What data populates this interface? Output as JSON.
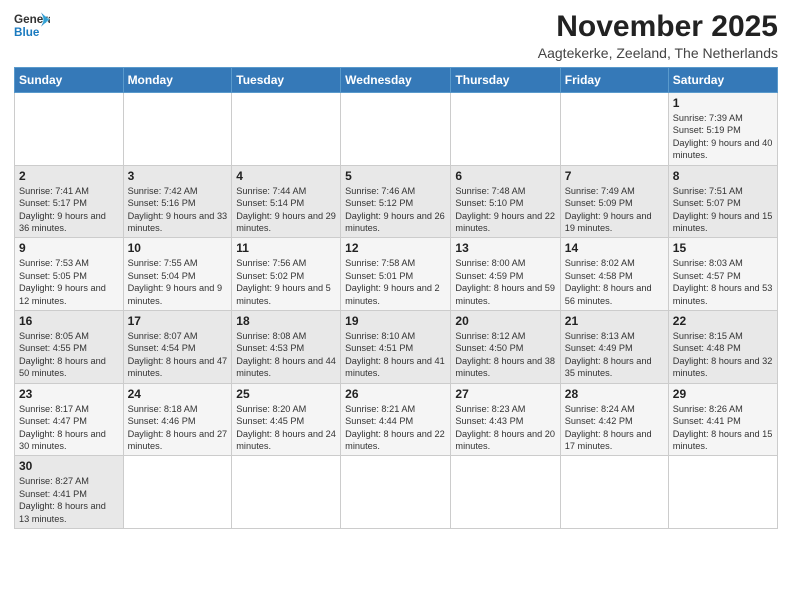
{
  "logo": {
    "text_general": "General",
    "text_blue": "Blue"
  },
  "header": {
    "month_title": "November 2025",
    "subtitle": "Aagtekerke, Zeeland, The Netherlands"
  },
  "weekdays": [
    "Sunday",
    "Monday",
    "Tuesday",
    "Wednesday",
    "Thursday",
    "Friday",
    "Saturday"
  ],
  "weeks": [
    [
      {
        "day": "",
        "info": ""
      },
      {
        "day": "",
        "info": ""
      },
      {
        "day": "",
        "info": ""
      },
      {
        "day": "",
        "info": ""
      },
      {
        "day": "",
        "info": ""
      },
      {
        "day": "",
        "info": ""
      },
      {
        "day": "1",
        "info": "Sunrise: 7:39 AM\nSunset: 5:19 PM\nDaylight: 9 hours and 40 minutes."
      }
    ],
    [
      {
        "day": "2",
        "info": "Sunrise: 7:41 AM\nSunset: 5:17 PM\nDaylight: 9 hours and 36 minutes."
      },
      {
        "day": "3",
        "info": "Sunrise: 7:42 AM\nSunset: 5:16 PM\nDaylight: 9 hours and 33 minutes."
      },
      {
        "day": "4",
        "info": "Sunrise: 7:44 AM\nSunset: 5:14 PM\nDaylight: 9 hours and 29 minutes."
      },
      {
        "day": "5",
        "info": "Sunrise: 7:46 AM\nSunset: 5:12 PM\nDaylight: 9 hours and 26 minutes."
      },
      {
        "day": "6",
        "info": "Sunrise: 7:48 AM\nSunset: 5:10 PM\nDaylight: 9 hours and 22 minutes."
      },
      {
        "day": "7",
        "info": "Sunrise: 7:49 AM\nSunset: 5:09 PM\nDaylight: 9 hours and 19 minutes."
      },
      {
        "day": "8",
        "info": "Sunrise: 7:51 AM\nSunset: 5:07 PM\nDaylight: 9 hours and 15 minutes."
      }
    ],
    [
      {
        "day": "9",
        "info": "Sunrise: 7:53 AM\nSunset: 5:05 PM\nDaylight: 9 hours and 12 minutes."
      },
      {
        "day": "10",
        "info": "Sunrise: 7:55 AM\nSunset: 5:04 PM\nDaylight: 9 hours and 9 minutes."
      },
      {
        "day": "11",
        "info": "Sunrise: 7:56 AM\nSunset: 5:02 PM\nDaylight: 9 hours and 5 minutes."
      },
      {
        "day": "12",
        "info": "Sunrise: 7:58 AM\nSunset: 5:01 PM\nDaylight: 9 hours and 2 minutes."
      },
      {
        "day": "13",
        "info": "Sunrise: 8:00 AM\nSunset: 4:59 PM\nDaylight: 8 hours and 59 minutes."
      },
      {
        "day": "14",
        "info": "Sunrise: 8:02 AM\nSunset: 4:58 PM\nDaylight: 8 hours and 56 minutes."
      },
      {
        "day": "15",
        "info": "Sunrise: 8:03 AM\nSunset: 4:57 PM\nDaylight: 8 hours and 53 minutes."
      }
    ],
    [
      {
        "day": "16",
        "info": "Sunrise: 8:05 AM\nSunset: 4:55 PM\nDaylight: 8 hours and 50 minutes."
      },
      {
        "day": "17",
        "info": "Sunrise: 8:07 AM\nSunset: 4:54 PM\nDaylight: 8 hours and 47 minutes."
      },
      {
        "day": "18",
        "info": "Sunrise: 8:08 AM\nSunset: 4:53 PM\nDaylight: 8 hours and 44 minutes."
      },
      {
        "day": "19",
        "info": "Sunrise: 8:10 AM\nSunset: 4:51 PM\nDaylight: 8 hours and 41 minutes."
      },
      {
        "day": "20",
        "info": "Sunrise: 8:12 AM\nSunset: 4:50 PM\nDaylight: 8 hours and 38 minutes."
      },
      {
        "day": "21",
        "info": "Sunrise: 8:13 AM\nSunset: 4:49 PM\nDaylight: 8 hours and 35 minutes."
      },
      {
        "day": "22",
        "info": "Sunrise: 8:15 AM\nSunset: 4:48 PM\nDaylight: 8 hours and 32 minutes."
      }
    ],
    [
      {
        "day": "23",
        "info": "Sunrise: 8:17 AM\nSunset: 4:47 PM\nDaylight: 8 hours and 30 minutes."
      },
      {
        "day": "24",
        "info": "Sunrise: 8:18 AM\nSunset: 4:46 PM\nDaylight: 8 hours and 27 minutes."
      },
      {
        "day": "25",
        "info": "Sunrise: 8:20 AM\nSunset: 4:45 PM\nDaylight: 8 hours and 24 minutes."
      },
      {
        "day": "26",
        "info": "Sunrise: 8:21 AM\nSunset: 4:44 PM\nDaylight: 8 hours and 22 minutes."
      },
      {
        "day": "27",
        "info": "Sunrise: 8:23 AM\nSunset: 4:43 PM\nDaylight: 8 hours and 20 minutes."
      },
      {
        "day": "28",
        "info": "Sunrise: 8:24 AM\nSunset: 4:42 PM\nDaylight: 8 hours and 17 minutes."
      },
      {
        "day": "29",
        "info": "Sunrise: 8:26 AM\nSunset: 4:41 PM\nDaylight: 8 hours and 15 minutes."
      }
    ],
    [
      {
        "day": "30",
        "info": "Sunrise: 8:27 AM\nSunset: 4:41 PM\nDaylight: 8 hours and 13 minutes."
      },
      {
        "day": "",
        "info": ""
      },
      {
        "day": "",
        "info": ""
      },
      {
        "day": "",
        "info": ""
      },
      {
        "day": "",
        "info": ""
      },
      {
        "day": "",
        "info": ""
      },
      {
        "day": "",
        "info": ""
      }
    ]
  ]
}
